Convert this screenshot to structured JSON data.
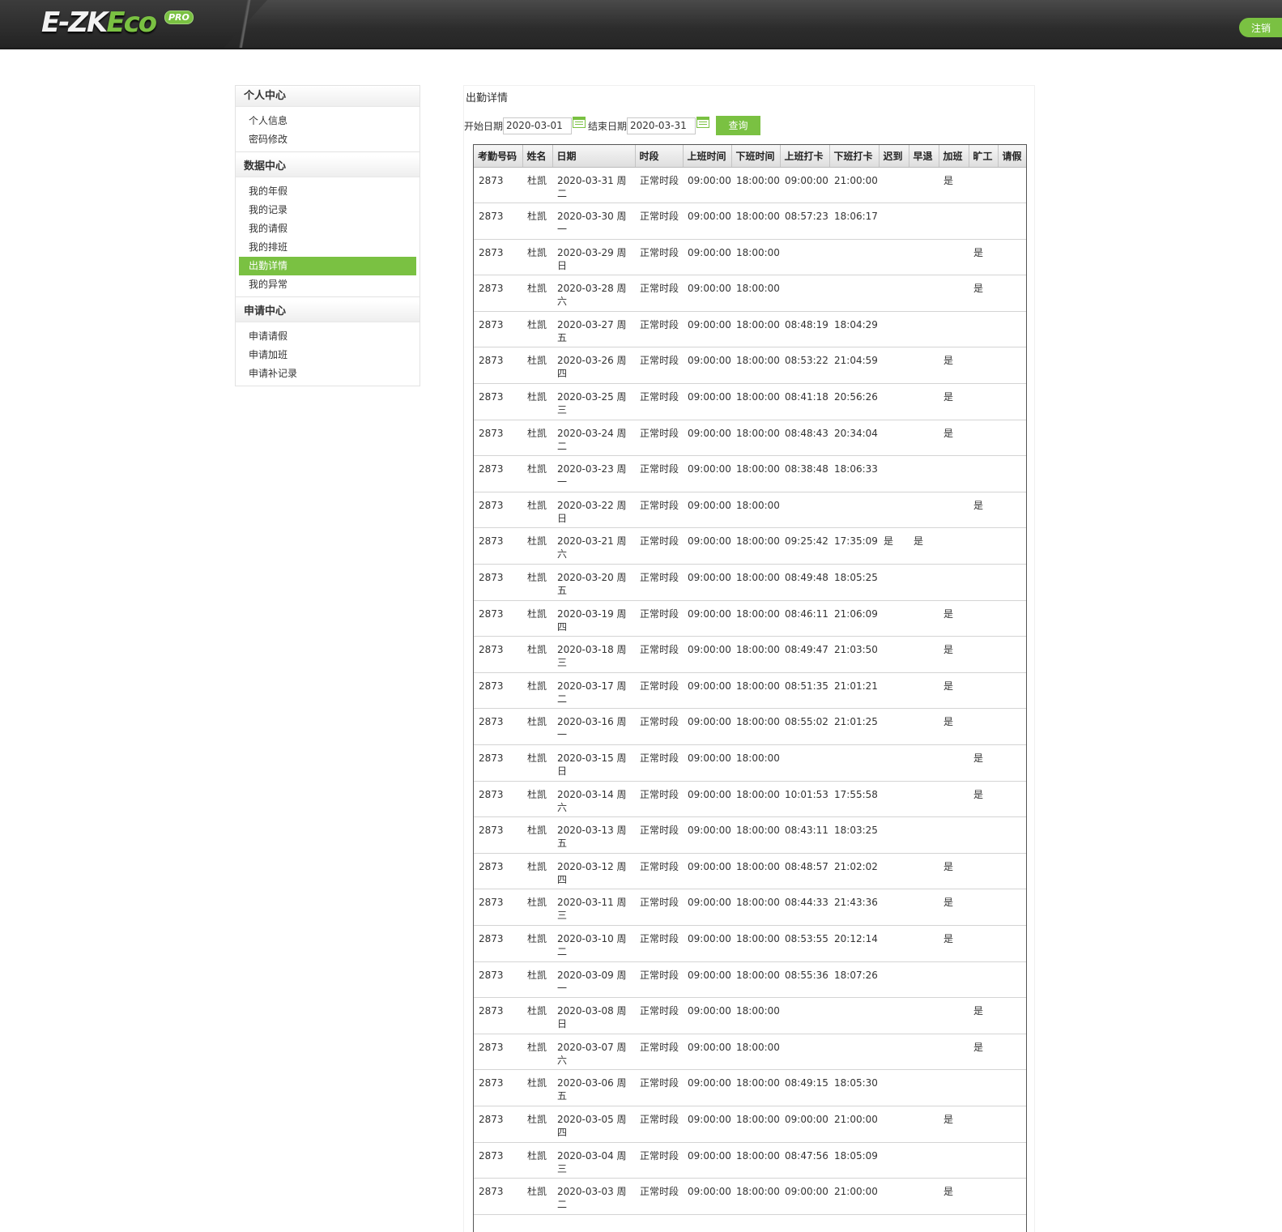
{
  "header": {
    "logo_main": "E-ZK",
    "logo_accent": "Eco",
    "logo_badge": "PRO",
    "logout_label": "注销"
  },
  "sidebar": {
    "groups": [
      {
        "title": "个人中心",
        "items": [
          "个人信息",
          "密码修改"
        ]
      },
      {
        "title": "数据中心",
        "items": [
          "我的年假",
          "我的记录",
          "我的请假",
          "我的排班",
          "出勤详情",
          "我的异常"
        ]
      },
      {
        "title": "申请中心",
        "items": [
          "申请请假",
          "申请加班",
          "申请补记录"
        ]
      }
    ],
    "active_item": "出勤详情"
  },
  "main": {
    "title": "出勤详情",
    "filter": {
      "start_label": "开始日期",
      "start_value": "2020-03-01",
      "end_label": "结束日期",
      "end_value": "2020-03-31",
      "query_label": "查询"
    },
    "table": {
      "columns": [
        "考勤号码",
        "姓名",
        "日期",
        "时段",
        "上班时间",
        "下班时间",
        "上班打卡",
        "下班打卡",
        "迟到",
        "早退",
        "加班",
        "旷工",
        "请假"
      ],
      "rows": [
        [
          "2873",
          "杜凯",
          "2020-03-31 周二",
          "正常时段",
          "09:00:00",
          "18:00:00",
          "09:00:00",
          "21:00:00",
          "",
          "",
          "是",
          "",
          ""
        ],
        [
          "2873",
          "杜凯",
          "2020-03-30 周一",
          "正常时段",
          "09:00:00",
          "18:00:00",
          "08:57:23",
          "18:06:17",
          "",
          "",
          "",
          "",
          ""
        ],
        [
          "2873",
          "杜凯",
          "2020-03-29 周日",
          "正常时段",
          "09:00:00",
          "18:00:00",
          "",
          "",
          "",
          "",
          "",
          "是",
          ""
        ],
        [
          "2873",
          "杜凯",
          "2020-03-28 周六",
          "正常时段",
          "09:00:00",
          "18:00:00",
          "",
          "",
          "",
          "",
          "",
          "是",
          ""
        ],
        [
          "2873",
          "杜凯",
          "2020-03-27 周五",
          "正常时段",
          "09:00:00",
          "18:00:00",
          "08:48:19",
          "18:04:29",
          "",
          "",
          "",
          "",
          ""
        ],
        [
          "2873",
          "杜凯",
          "2020-03-26 周四",
          "正常时段",
          "09:00:00",
          "18:00:00",
          "08:53:22",
          "21:04:59",
          "",
          "",
          "是",
          "",
          ""
        ],
        [
          "2873",
          "杜凯",
          "2020-03-25 周三",
          "正常时段",
          "09:00:00",
          "18:00:00",
          "08:41:18",
          "20:56:26",
          "",
          "",
          "是",
          "",
          ""
        ],
        [
          "2873",
          "杜凯",
          "2020-03-24 周二",
          "正常时段",
          "09:00:00",
          "18:00:00",
          "08:48:43",
          "20:34:04",
          "",
          "",
          "是",
          "",
          ""
        ],
        [
          "2873",
          "杜凯",
          "2020-03-23 周一",
          "正常时段",
          "09:00:00",
          "18:00:00",
          "08:38:48",
          "18:06:33",
          "",
          "",
          "",
          "",
          ""
        ],
        [
          "2873",
          "杜凯",
          "2020-03-22 周日",
          "正常时段",
          "09:00:00",
          "18:00:00",
          "",
          "",
          "",
          "",
          "",
          "是",
          ""
        ],
        [
          "2873",
          "杜凯",
          "2020-03-21 周六",
          "正常时段",
          "09:00:00",
          "18:00:00",
          "09:25:42",
          "17:35:09",
          "是",
          "是",
          "",
          "",
          ""
        ],
        [
          "2873",
          "杜凯",
          "2020-03-20 周五",
          "正常时段",
          "09:00:00",
          "18:00:00",
          "08:49:48",
          "18:05:25",
          "",
          "",
          "",
          "",
          ""
        ],
        [
          "2873",
          "杜凯",
          "2020-03-19 周四",
          "正常时段",
          "09:00:00",
          "18:00:00",
          "08:46:11",
          "21:06:09",
          "",
          "",
          "是",
          "",
          ""
        ],
        [
          "2873",
          "杜凯",
          "2020-03-18 周三",
          "正常时段",
          "09:00:00",
          "18:00:00",
          "08:49:47",
          "21:03:50",
          "",
          "",
          "是",
          "",
          ""
        ],
        [
          "2873",
          "杜凯",
          "2020-03-17 周二",
          "正常时段",
          "09:00:00",
          "18:00:00",
          "08:51:35",
          "21:01:21",
          "",
          "",
          "是",
          "",
          ""
        ],
        [
          "2873",
          "杜凯",
          "2020-03-16 周一",
          "正常时段",
          "09:00:00",
          "18:00:00",
          "08:55:02",
          "21:01:25",
          "",
          "",
          "是",
          "",
          ""
        ],
        [
          "2873",
          "杜凯",
          "2020-03-15 周日",
          "正常时段",
          "09:00:00",
          "18:00:00",
          "",
          "",
          "",
          "",
          "",
          "是",
          ""
        ],
        [
          "2873",
          "杜凯",
          "2020-03-14 周六",
          "正常时段",
          "09:00:00",
          "18:00:00",
          "10:01:53",
          "17:55:58",
          "",
          "",
          "",
          "是",
          ""
        ],
        [
          "2873",
          "杜凯",
          "2020-03-13 周五",
          "正常时段",
          "09:00:00",
          "18:00:00",
          "08:43:11",
          "18:03:25",
          "",
          "",
          "",
          "",
          ""
        ],
        [
          "2873",
          "杜凯",
          "2020-03-12 周四",
          "正常时段",
          "09:00:00",
          "18:00:00",
          "08:48:57",
          "21:02:02",
          "",
          "",
          "是",
          "",
          ""
        ],
        [
          "2873",
          "杜凯",
          "2020-03-11 周三",
          "正常时段",
          "09:00:00",
          "18:00:00",
          "08:44:33",
          "21:43:36",
          "",
          "",
          "是",
          "",
          ""
        ],
        [
          "2873",
          "杜凯",
          "2020-03-10 周二",
          "正常时段",
          "09:00:00",
          "18:00:00",
          "08:53:55",
          "20:12:14",
          "",
          "",
          "是",
          "",
          ""
        ],
        [
          "2873",
          "杜凯",
          "2020-03-09 周一",
          "正常时段",
          "09:00:00",
          "18:00:00",
          "08:55:36",
          "18:07:26",
          "",
          "",
          "",
          "",
          ""
        ],
        [
          "2873",
          "杜凯",
          "2020-03-08 周日",
          "正常时段",
          "09:00:00",
          "18:00:00",
          "",
          "",
          "",
          "",
          "",
          "是",
          ""
        ],
        [
          "2873",
          "杜凯",
          "2020-03-07 周六",
          "正常时段",
          "09:00:00",
          "18:00:00",
          "",
          "",
          "",
          "",
          "",
          "是",
          ""
        ],
        [
          "2873",
          "杜凯",
          "2020-03-06 周五",
          "正常时段",
          "09:00:00",
          "18:00:00",
          "08:49:15",
          "18:05:30",
          "",
          "",
          "",
          "",
          ""
        ],
        [
          "2873",
          "杜凯",
          "2020-03-05 周四",
          "正常时段",
          "09:00:00",
          "18:00:00",
          "09:00:00",
          "21:00:00",
          "",
          "",
          "是",
          "",
          ""
        ],
        [
          "2873",
          "杜凯",
          "2020-03-04 周三",
          "正常时段",
          "09:00:00",
          "18:00:00",
          "08:47:56",
          "18:05:09",
          "",
          "",
          "",
          "",
          ""
        ],
        [
          "2873",
          "杜凯",
          "2020-03-03 周二",
          "正常时段",
          "09:00:00",
          "18:00:00",
          "09:00:00",
          "21:00:00",
          "",
          "",
          "是",
          "",
          ""
        ]
      ]
    }
  },
  "colors": {
    "accent": "#7ac142",
    "header_bg": "#2c2c2c"
  }
}
